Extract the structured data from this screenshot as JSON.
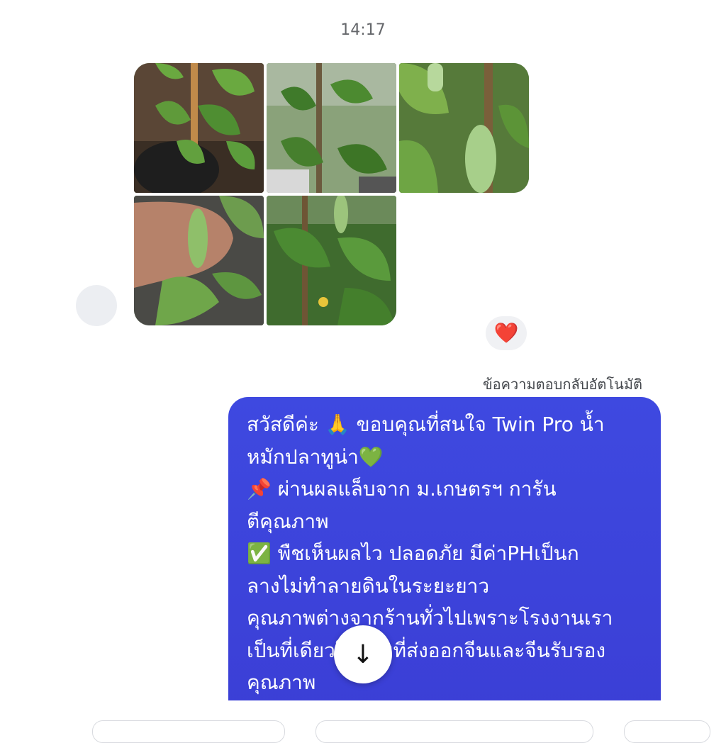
{
  "timestamp": "14:17",
  "photos": [
    {
      "name": "cucumber seedling in pot"
    },
    {
      "name": "cucumber vines on trellis"
    },
    {
      "name": "cucumber hanging on vine"
    },
    {
      "name": "small cucumber in hand"
    },
    {
      "name": "cucumber plant with flowers"
    }
  ],
  "reaction": {
    "emoji": "❤️"
  },
  "auto_reply_label": "ข้อความตอบกลับอัตโนมัติ",
  "bubble": {
    "text": "สวัสดีค่ะ 🙏 ขอบคุณที่สนใจ Twin Pro น้ำ\nหมักปลาทูน่า💚\n📌 ผ่านผลแล็บจาก ม.เกษตรฯ การัน\nตีคุณภาพ\n✅ พืชเห็นผลไว ปลอดภัย มีค่าPHเป็นก\nลางไม่ทำลายดินในระยะยาว\nคุณภาพต่างจากร้านทั่วไปเพราะโรงงานเรา\nเป็นที่เดียวในไทยที่ส่งออกจีนและจีนรับรอง\nคุณภาพ",
    "color": "#3e49e0"
  },
  "scroll_button": {
    "icon": "arrow-down-icon",
    "glyph": "↓"
  }
}
